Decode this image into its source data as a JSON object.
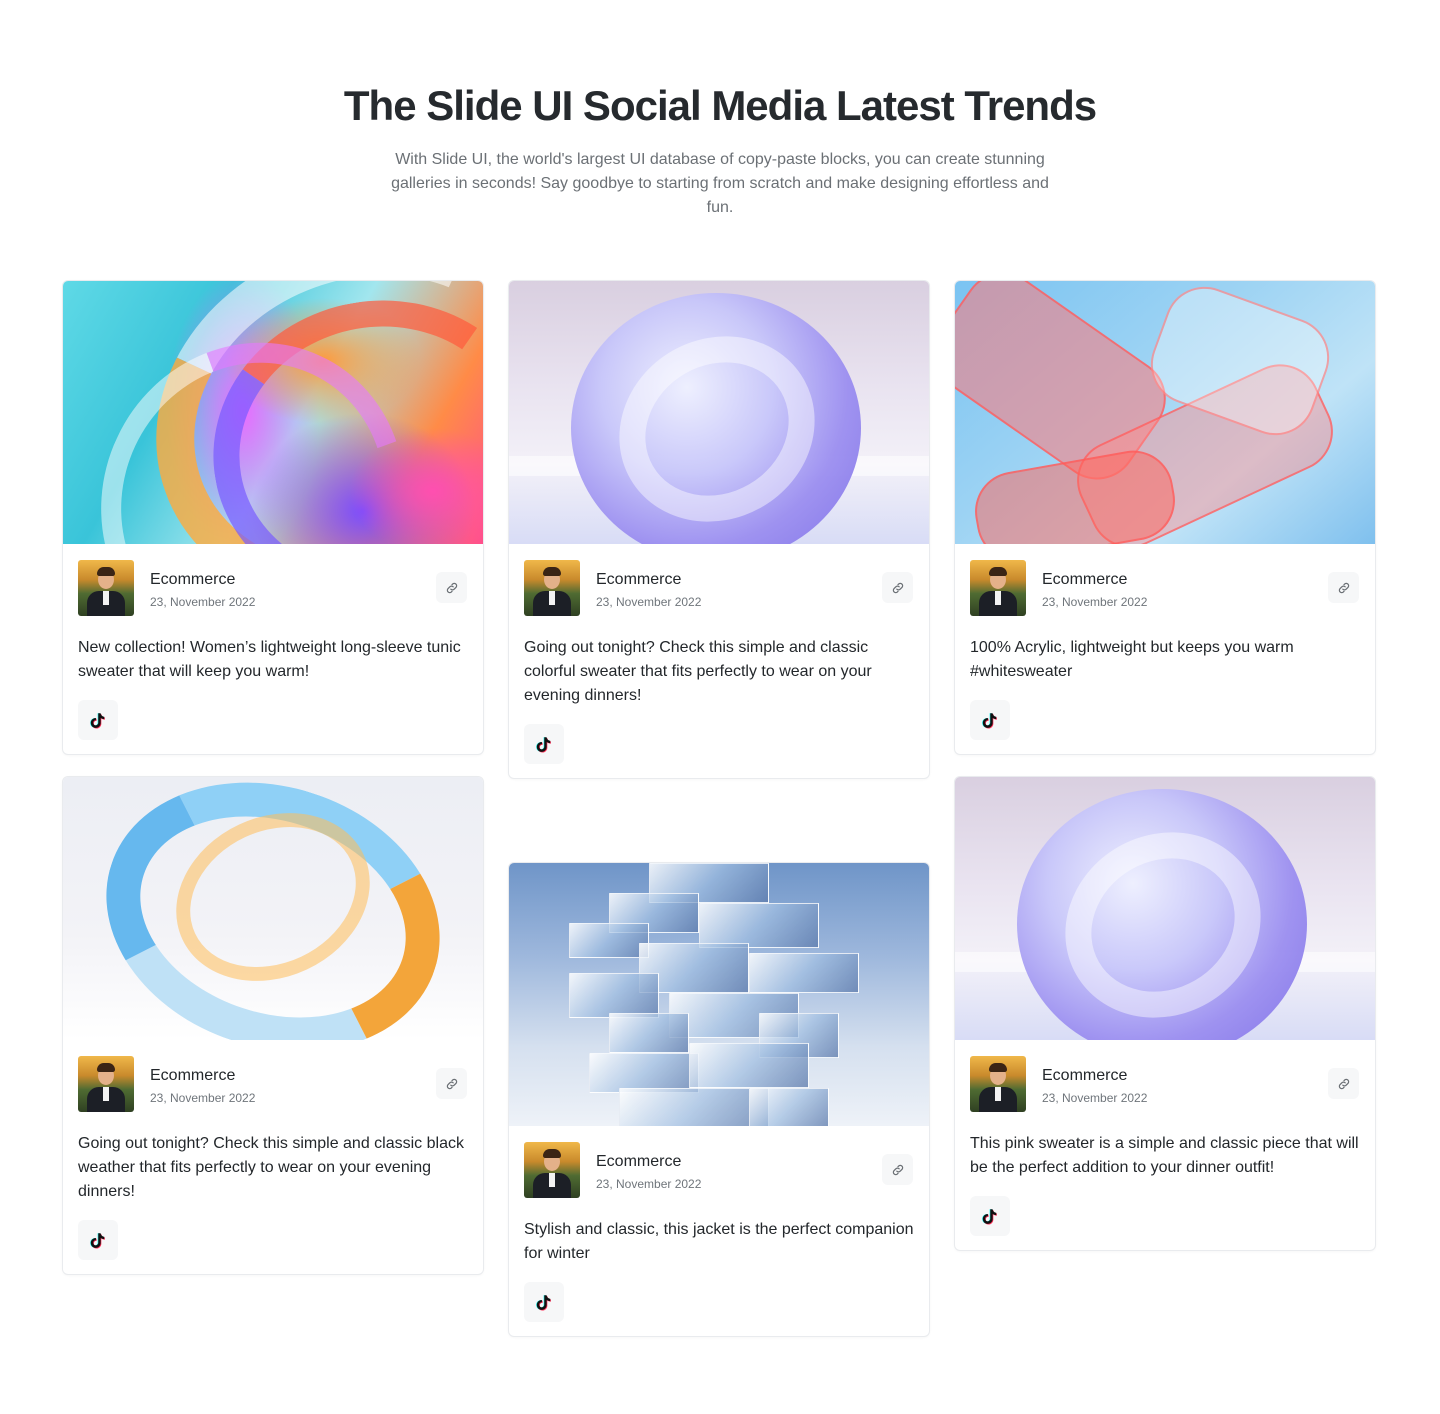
{
  "header": {
    "title": "The Slide UI Social Media Latest Trends",
    "subtitle": "With Slide UI, the world's largest UI database of copy-paste blocks, you can create stunning galleries in seconds! Say goodbye to starting from scratch and make designing effortless and fun."
  },
  "posts": [
    {
      "author": "Ecommerce",
      "date": "23, November 2022",
      "text": "New collection! Women’s lightweight long-sleeve tunic sweater that will keep you warm!",
      "image": "colorful-swirl"
    },
    {
      "author": "Ecommerce",
      "date": "23, November 2022",
      "text": "Going out tonight? Check this simple and classic colorful sweater that fits perfectly to wear on your evening dinners!",
      "image": "glass-sphere"
    },
    {
      "author": "Ecommerce",
      "date": "23, November 2022",
      "text": "100% Acrylic, lightweight but keeps you warm #whitesweater",
      "image": "pink-ribbons"
    },
    {
      "author": "Ecommerce",
      "date": "23, November 2022",
      "text": "Going out tonight? Check this simple and classic black weather that fits perfectly to wear on your evening dinners!",
      "image": "glass-ring"
    },
    {
      "author": "Ecommerce",
      "date": "23, November 2022",
      "text": "Stylish and classic, this jacket is the perfect companion for winter",
      "image": "glass-tower"
    },
    {
      "author": "Ecommerce",
      "date": "23, November 2022",
      "text": "This pink sweater is a simple and classic piece that will be the perfect addition to your dinner outfit!",
      "image": "glass-sphere"
    }
  ],
  "icons": {
    "link": "link-icon",
    "social": "tiktok-icon"
  },
  "colors": {
    "title": "#262a2e",
    "subtitle": "#6b7075",
    "card_border": "#e9ebee",
    "button_bg": "#f6f7f8"
  }
}
